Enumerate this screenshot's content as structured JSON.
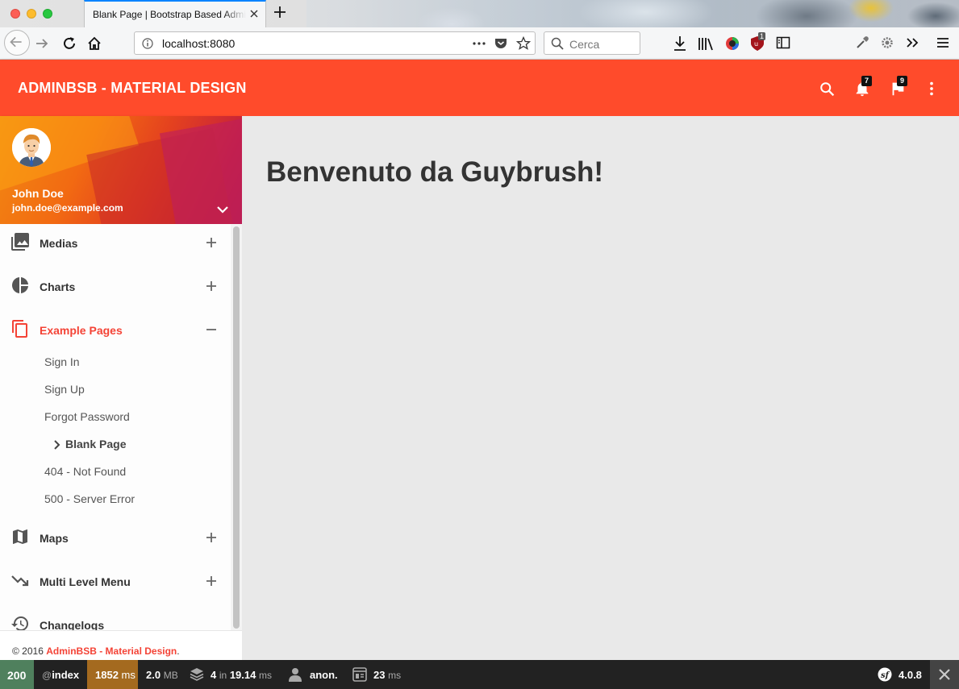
{
  "browser": {
    "tab_title": "Blank Page | Bootstrap Based Admin Template - Material Design",
    "url": "localhost:8080",
    "search_placeholder": "Cerca",
    "extension_badge": "1"
  },
  "header": {
    "brand": "ADMINBSB - MATERIAL DESIGN",
    "notifications_count": "7",
    "tasks_count": "9"
  },
  "user": {
    "name": "John Doe",
    "email": "john.doe@example.com"
  },
  "menu": {
    "items": [
      {
        "label": "Medias",
        "icon": "photo-library-icon",
        "toggle": "+"
      },
      {
        "label": "Charts",
        "icon": "pie-chart-icon",
        "toggle": "+"
      },
      {
        "label": "Example Pages",
        "icon": "content-copy-icon",
        "toggle": "−"
      },
      {
        "label": "Maps",
        "icon": "map-icon",
        "toggle": "+"
      },
      {
        "label": "Multi Level Menu",
        "icon": "trending-down-icon",
        "toggle": "+"
      },
      {
        "label": "Changelogs",
        "icon": "history-icon"
      }
    ],
    "subitems": [
      "Sign In",
      "Sign Up",
      "Forgot Password",
      "Blank Page",
      "404 - Not Found",
      "500 - Server Error"
    ],
    "active_item": "Example Pages",
    "current_subitem": "Blank Page"
  },
  "footer": {
    "copyright": "© 2016",
    "link": "AdminBSB - Material Design",
    "suffix": "."
  },
  "content": {
    "title": "Benvenuto da Guybrush!"
  },
  "profiler": {
    "status": "200",
    "route_prefix": "@",
    "route": "index",
    "time_value": "1852",
    "time_unit": "ms",
    "memory_value": "2.0",
    "memory_unit": "MB",
    "db_queries": "4",
    "db_in": "in",
    "db_time": "19.14",
    "db_unit": "ms",
    "user": "anon.",
    "twig_time": "23",
    "twig_unit": "ms",
    "symfony_version": "4.0.8"
  },
  "colors": {
    "header": "#ff4b2b",
    "accent": "#f44336",
    "status_ok": "#4f805d",
    "time_warning": "#a46a1f"
  }
}
